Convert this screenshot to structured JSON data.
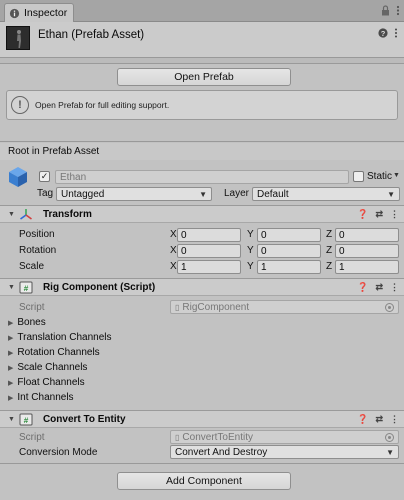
{
  "tab": {
    "label": "Inspector",
    "icon": "info-icon"
  },
  "tab_icons": [
    "lock-icon",
    "menu-icon"
  ],
  "header": {
    "title": "Ethan (Prefab Asset)",
    "icons": [
      "help-icon",
      "settings-icon"
    ]
  },
  "open_prefab_label": "Open Prefab",
  "help_text": "Open Prefab for full editing support.",
  "root_label": "Root in Prefab Asset",
  "gameobject": {
    "active": true,
    "name": "Ethan",
    "static_label": "Static",
    "static_checked": false,
    "tag_label": "Tag",
    "tag_value": "Untagged",
    "layer_label": "Layer",
    "layer_value": "Default"
  },
  "transform": {
    "title": "Transform",
    "rows": [
      {
        "label": "Position",
        "x": "0",
        "y": "0",
        "z": "0"
      },
      {
        "label": "Rotation",
        "x": "0",
        "y": "0",
        "z": "0"
      },
      {
        "label": "Scale",
        "x": "1",
        "y": "1",
        "z": "1"
      }
    ],
    "axes": [
      "X",
      "Y",
      "Z"
    ]
  },
  "rig": {
    "title": "Rig Component (Script)",
    "script_label": "Script",
    "script_value": "RigComponent",
    "foldouts": [
      "Bones",
      "Translation Channels",
      "Rotation Channels",
      "Scale Channels",
      "Float Channels",
      "Int Channels"
    ]
  },
  "convert": {
    "title": "Convert To Entity",
    "script_label": "Script",
    "script_value": "ConvertToEntity",
    "mode_label": "Conversion Mode",
    "mode_value": "Convert And Destroy"
  },
  "add_component_label": "Add Component",
  "colors": {
    "background": "#c2c2c2",
    "transform_icon_blue": "#2f6bd6",
    "transform_icon_red": "#d24040",
    "transform_icon_green": "#3aa65a",
    "cube_blue": "#3b7fd0"
  }
}
